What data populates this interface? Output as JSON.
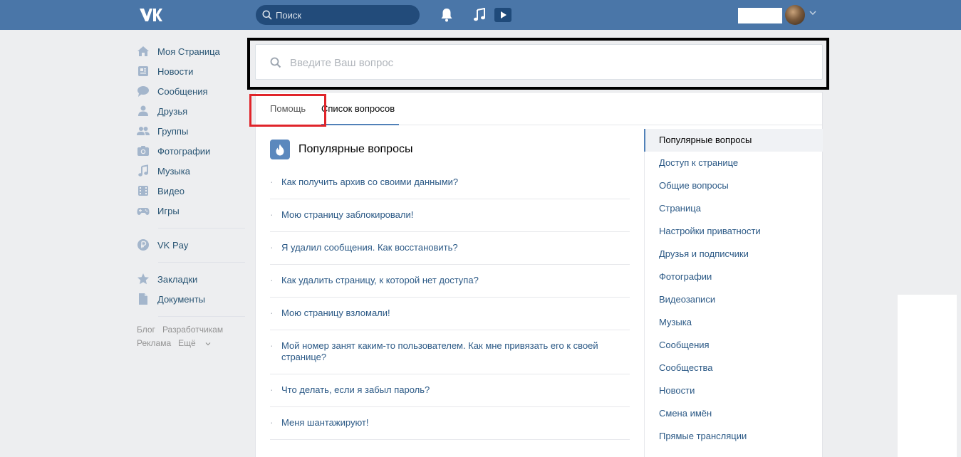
{
  "header": {
    "search_placeholder": "Поиск"
  },
  "nav": {
    "main": [
      {
        "label": "Моя Страница",
        "icon": "home-icon"
      },
      {
        "label": "Новости",
        "icon": "news-icon"
      },
      {
        "label": "Сообщения",
        "icon": "messages-icon"
      },
      {
        "label": "Друзья",
        "icon": "friend-icon"
      },
      {
        "label": "Группы",
        "icon": "groups-icon"
      },
      {
        "label": "Фотографии",
        "icon": "camera-icon"
      },
      {
        "label": "Музыка",
        "icon": "music-icon"
      },
      {
        "label": "Видео",
        "icon": "video-icon"
      },
      {
        "label": "Игры",
        "icon": "gamepad-icon"
      }
    ],
    "pay": {
      "label": "VK Pay",
      "icon": "vkpay-icon"
    },
    "extra": [
      {
        "label": "Закладки",
        "icon": "star-icon"
      },
      {
        "label": "Документы",
        "icon": "document-icon"
      }
    ],
    "footer": [
      "Блог",
      "Разработчикам",
      "Реклама",
      "Ещё"
    ]
  },
  "faq_search": {
    "placeholder": "Введите Ваш вопрос"
  },
  "tabs": {
    "help": "Помощь",
    "list": "Список вопросов"
  },
  "popular": {
    "title": "Популярные вопросы",
    "questions": [
      "Как получить архив со своими данными?",
      "Мою страницу заблокировали!",
      "Я удалил сообщения. Как восстановить?",
      "Как удалить страницу, к которой нет доступа?",
      "Мою страницу взломали!",
      "Мой номер занят каким-то пользователем. Как мне привязать его к своей странице?",
      "Что делать, если я забыл пароль?",
      "Меня шантажируют!"
    ]
  },
  "categories": [
    "Популярные вопросы",
    "Доступ к странице",
    "Общие вопросы",
    "Страница",
    "Настройки приватности",
    "Друзья и подписчики",
    "Фотографии",
    "Видеозаписи",
    "Музыка",
    "Сообщения",
    "Сообщества",
    "Новости",
    "Смена имён",
    "Прямые трансляции"
  ],
  "colors": {
    "header_bg": "#4a76a8",
    "link": "#2a5885",
    "accent": "#5181b8",
    "highlight_red": "#e0242a",
    "highlight_black": "#000000"
  }
}
